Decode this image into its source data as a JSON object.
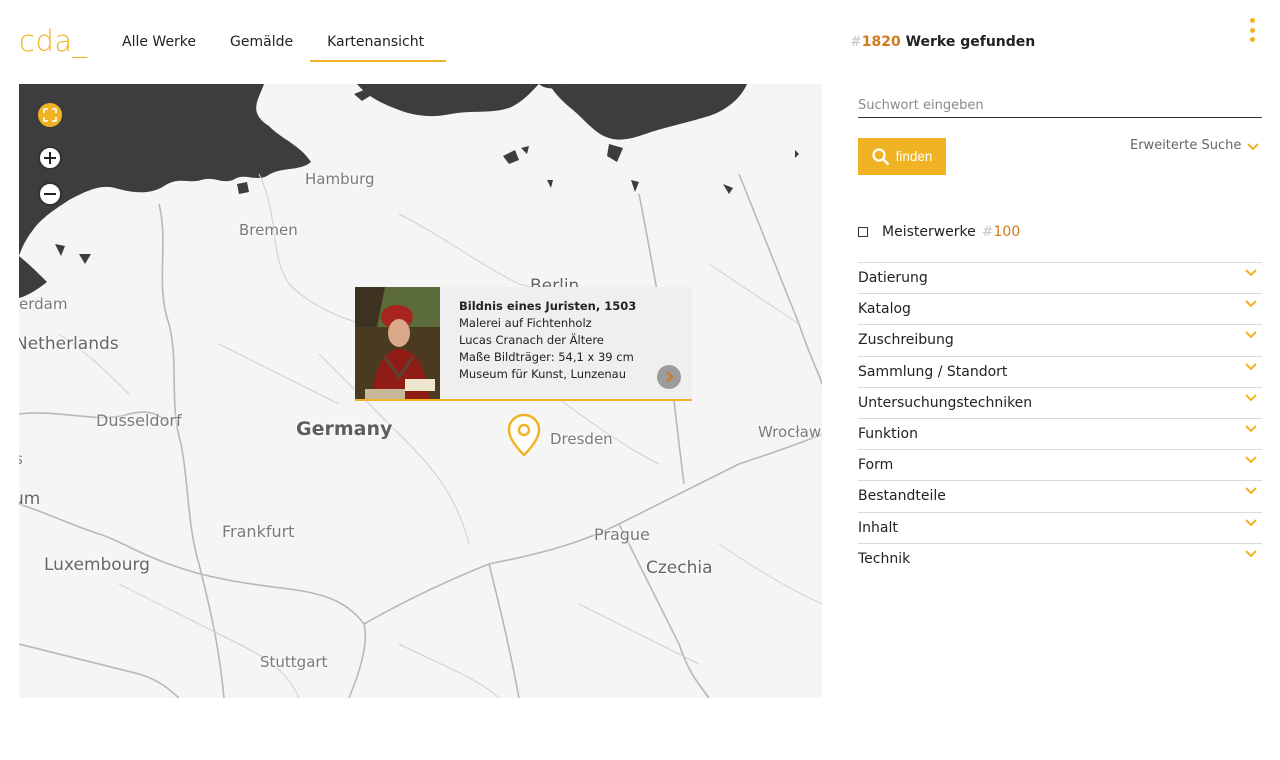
{
  "header": {
    "logo": "cda_",
    "nav": [
      "Alle Werke",
      "Gemälde",
      "Kartenansicht"
    ],
    "active_nav": "Kartenansicht"
  },
  "results": {
    "hash": "#",
    "count": "1820",
    "label": "Werke gefunden"
  },
  "search": {
    "placeholder": "Suchwort eingeben",
    "value": ""
  },
  "find_button": {
    "label": "finden",
    "icon": "search-icon"
  },
  "advanced_search": {
    "label": "Erweiterte Suche",
    "icon": "chevron-down-icon"
  },
  "masterpieces": {
    "label": "Meisterwerke",
    "hash": "#",
    "count": "100",
    "checked": false
  },
  "facets": [
    "Datierung",
    "Katalog",
    "Zuschreibung",
    "Sammlung / Standort",
    "Untersuchungstechniken",
    "Funktion",
    "Form",
    "Bestandteile",
    "Inhalt",
    "Technik"
  ],
  "map": {
    "labels": {
      "hamburg": "Hamburg",
      "bremen": "Bremen",
      "berlin": "Berlin",
      "amsterdam": "erdam",
      "netherlands": "Netherlands",
      "dusseldorf": "Dusseldorf",
      "germany": "Germany",
      "dresden": "Dresden",
      "wroclaw": "Wrocław",
      "s": "s",
      "um": "um",
      "frankfurt": "Frankfurt",
      "prague": "Prague",
      "luxembourg": "Luxembourg",
      "czechia": "Czechia",
      "stuttgart": "Stuttgart"
    },
    "controls": [
      "fullscreen-icon",
      "zoom-in-icon",
      "zoom-out-icon"
    ]
  },
  "popup": {
    "title": "Bildnis eines Juristen, 1503",
    "line1": "Malerei auf Fichtenholz",
    "line2": "Lucas Cranach der Ältere",
    "line3": "Maße Bildträger: 54,1 x 39 cm",
    "line4": "Museum für Kunst, Lunzenau"
  },
  "colors": {
    "accent": "#f0b323",
    "count": "#d07a1a",
    "sea": "#3d3d3d"
  }
}
